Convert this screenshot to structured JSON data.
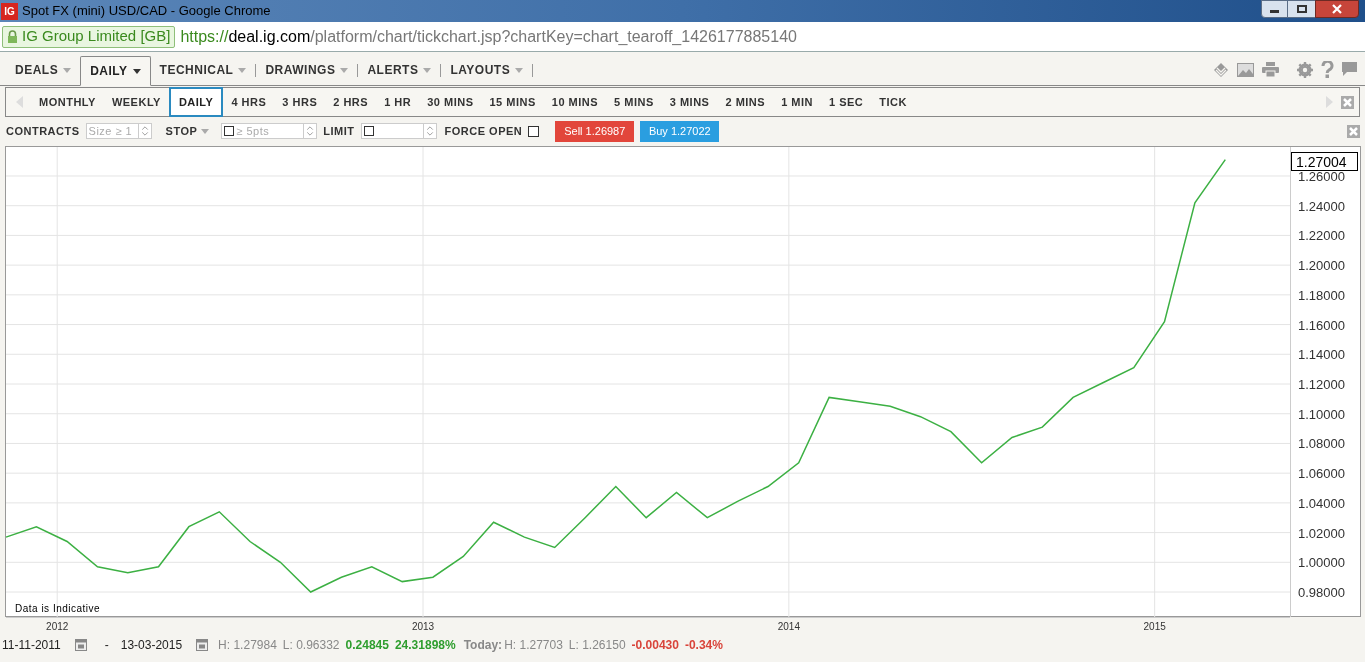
{
  "window": {
    "logo": "IG",
    "title": "Spot FX (mini) USD/CAD - Google Chrome"
  },
  "address_bar": {
    "identity": "IG Group Limited [GB]",
    "scheme": "https://",
    "host": "deal.ig.com",
    "path": "/platform/chart/tickchart.jsp?chartKey=chart_tearoff_1426177885140"
  },
  "menu": [
    {
      "label": "DEALS",
      "selected": false,
      "divider": false
    },
    {
      "label": "DAILY",
      "selected": true,
      "divider": false
    },
    {
      "label": "TECHNICAL",
      "selected": false,
      "divider": true
    },
    {
      "label": "DRAWINGS",
      "selected": false,
      "divider": true
    },
    {
      "label": "ALERTS",
      "selected": false,
      "divider": true
    },
    {
      "label": "LAYOUTS",
      "selected": false,
      "divider": true
    }
  ],
  "timeframes": [
    {
      "label": "MONTHLY",
      "selected": false
    },
    {
      "label": "WEEKLY",
      "selected": false
    },
    {
      "label": "DAILY",
      "selected": true
    },
    {
      "label": "4 HRS",
      "selected": false
    },
    {
      "label": "3 HRS",
      "selected": false
    },
    {
      "label": "2 HRS",
      "selected": false
    },
    {
      "label": "1 HR",
      "selected": false
    },
    {
      "label": "30 MINS",
      "selected": false
    },
    {
      "label": "15 MINS",
      "selected": false
    },
    {
      "label": "10 MINS",
      "selected": false
    },
    {
      "label": "5 MINS",
      "selected": false
    },
    {
      "label": "3 MINS",
      "selected": false
    },
    {
      "label": "2 MINS",
      "selected": false
    },
    {
      "label": "1 MIN",
      "selected": false
    },
    {
      "label": "1 SEC",
      "selected": false
    },
    {
      "label": "TICK",
      "selected": false
    }
  ],
  "deal_bar": {
    "contracts_label": "CONTRACTS",
    "contracts_placeholder": "Size ≥ 1",
    "stop_label": "STOP",
    "stop_checked": false,
    "stop_placeholder": "≥ 5pts",
    "limit_label": "LIMIT",
    "limit_checked": false,
    "force_open_label": "FORCE OPEN",
    "force_open_checked": false,
    "sell": "Sell 1.26987",
    "buy": "Buy 1.27022"
  },
  "chart": {
    "note": "Data is Indicative",
    "current_price": "1.27004",
    "chart_data": {
      "type": "line",
      "x": [
        2011.86,
        2011.943,
        2012.027,
        2012.11,
        2012.193,
        2012.277,
        2012.36,
        2012.443,
        2012.527,
        2012.61,
        2012.693,
        2012.777,
        2012.86,
        2012.943,
        2013.027,
        2013.11,
        2013.193,
        2013.277,
        2013.36,
        2013.443,
        2013.527,
        2013.61,
        2013.693,
        2013.777,
        2013.86,
        2013.943,
        2014.027,
        2014.11,
        2014.193,
        2014.277,
        2014.36,
        2014.443,
        2014.527,
        2014.61,
        2014.693,
        2014.777,
        2014.86,
        2014.943,
        2015.027,
        2015.11,
        2015.193
      ],
      "series": [
        {
          "color": "#3cb043",
          "values": [
            1.017,
            1.024,
            1.014,
            0.997,
            0.993,
            0.997,
            1.024,
            1.034,
            1.014,
            1.0,
            0.98,
            0.99,
            0.997,
            0.987,
            0.99,
            1.004,
            1.027,
            1.017,
            1.01,
            1.03,
            1.051,
            1.03,
            1.047,
            1.03,
            1.041,
            1.051,
            1.067,
            1.111,
            1.108,
            1.105,
            1.098,
            1.088,
            1.067,
            1.084,
            1.091,
            1.111,
            1.121,
            1.131,
            1.162,
            1.242,
            1.271
          ]
        }
      ],
      "grid": true,
      "xlim": [
        2011.86,
        2015.37
      ],
      "ylim": [
        0.9632,
        1.2795
      ],
      "yticks": [
        {
          "value": 0.98,
          "label": "0.98000"
        },
        {
          "value": 1.0,
          "label": "1.00000"
        },
        {
          "value": 1.02,
          "label": "1.02000"
        },
        {
          "value": 1.04,
          "label": "1.04000"
        },
        {
          "value": 1.06,
          "label": "1.06000"
        },
        {
          "value": 1.08,
          "label": "1.08000"
        },
        {
          "value": 1.1,
          "label": "1.10000"
        },
        {
          "value": 1.12,
          "label": "1.12000"
        },
        {
          "value": 1.14,
          "label": "1.14000"
        },
        {
          "value": 1.16,
          "label": "1.16000"
        },
        {
          "value": 1.18,
          "label": "1.18000"
        },
        {
          "value": 1.2,
          "label": "1.20000"
        },
        {
          "value": 1.22,
          "label": "1.22000"
        },
        {
          "value": 1.24,
          "label": "1.24000"
        },
        {
          "value": 1.26,
          "label": "1.26000"
        }
      ],
      "xticks": [
        2012,
        2013,
        2014,
        2015
      ]
    }
  },
  "status_bar": {
    "from": "11-11-2011",
    "separator": "-",
    "to": "13-03-2015",
    "high": "H: 1.27984",
    "low": "L: 0.96332",
    "change": "0.24845",
    "change_pct": "24.31898%",
    "today_label": "Today:",
    "today_high": "H: 1.27703",
    "today_low": "L: 1.26150",
    "today_change": "-0.00430",
    "today_change_pct": "-0.34%"
  }
}
